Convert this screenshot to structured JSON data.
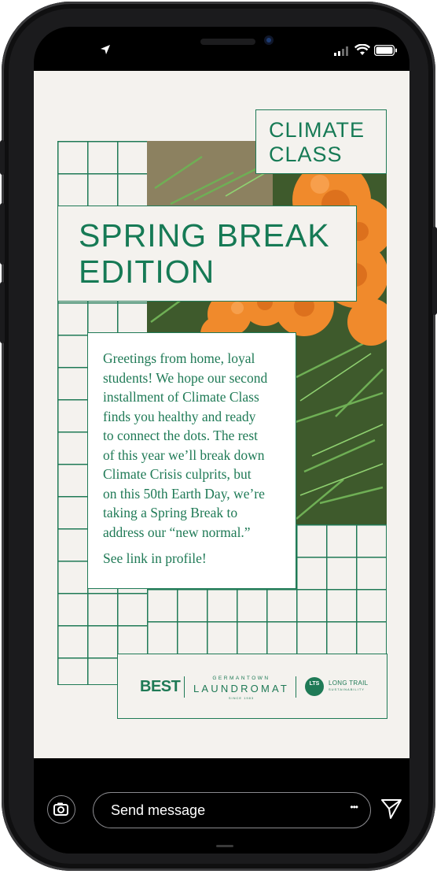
{
  "device": {
    "status_icons": [
      "location-arrow-icon",
      "signal-bars-icon",
      "wifi-icon",
      "battery-icon"
    ]
  },
  "story": {
    "header_small_line1": "CLIMATE",
    "header_small_line2": "CLASS",
    "title_line1": "SPRING BREAK",
    "title_line2": "EDITION",
    "body_paragraphs": [
      "Greetings from home, loyal",
      "students! We hope our second",
      "installment of Climate Class",
      "finds you healthy and ready",
      "to connect the dots. The rest",
      "of this year we’ll break down",
      "Climate Crisis culprits, but",
      "on this 50th Earth Day, we’re",
      "taking a Spring Break to",
      "address our “new normal.”"
    ],
    "cta": "See link in profile!",
    "logos": {
      "best": "BEST",
      "germantown": "GERMANTOWN",
      "laundromat": "LAUNDROMAT",
      "since": "SINCE 1983",
      "lts_badge": "LTS",
      "long_trail": "LONG TRAIL",
      "sustainability": "SUSTAINABILITY"
    },
    "colors": {
      "accent_green": "#1f7a56",
      "background": "#f4f2ee",
      "flower_orange": "#f08a2c"
    }
  },
  "message_bar": {
    "placeholder": "Send message",
    "more_label": "•••"
  }
}
